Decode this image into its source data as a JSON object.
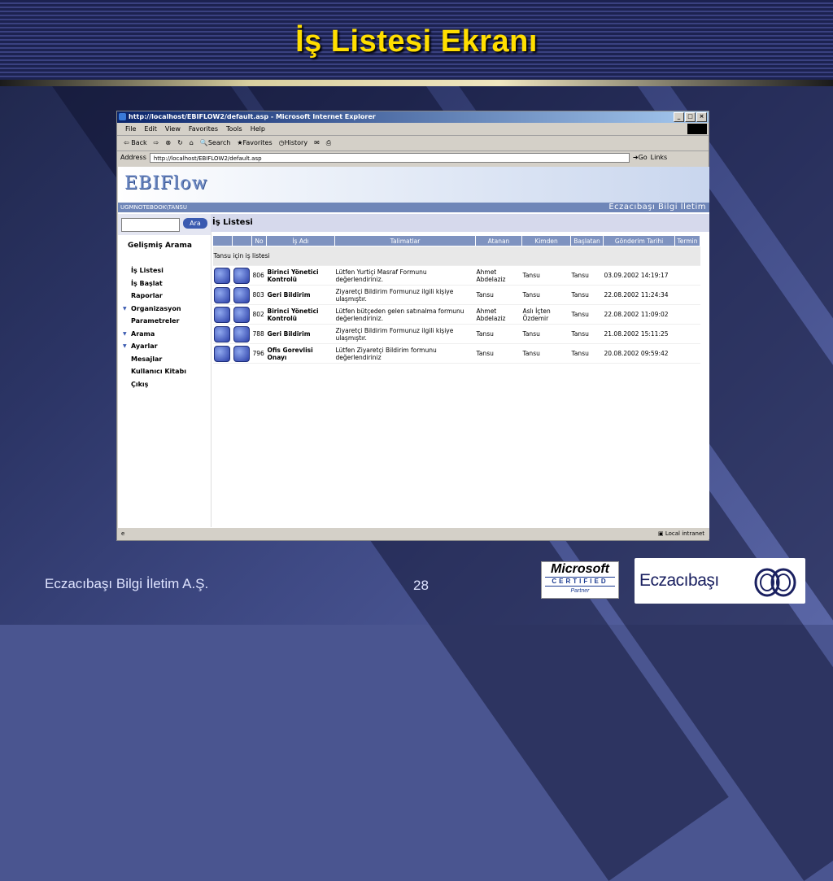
{
  "slide": {
    "title": "İş Listesi Ekranı",
    "footer_left": "Eczacıbaşı Bilgi İletim A.Ş.",
    "page_number": "28"
  },
  "logos": {
    "ms_certified": {
      "line1": "Microsoft",
      "line2": "CERTIFIED",
      "line3": "Partner"
    },
    "eczacibasi": "Eczacıbaşı"
  },
  "browser": {
    "title": "http://localhost/EBIFLOW2/default.asp - Microsoft Internet Explorer",
    "menu": [
      "File",
      "Edit",
      "View",
      "Favorites",
      "Tools",
      "Help"
    ],
    "toolbar": [
      "Back",
      "Search",
      "Favorites",
      "History"
    ],
    "address_label": "Address",
    "address_value": "http://localhost/EBIFLOW2/default.asp",
    "go_label": "Go",
    "links_label": "Links",
    "status_zone": "Local intranet"
  },
  "app": {
    "logo": "EBIFlow",
    "user_path": "UGMNOTEBOOK\\TANSU",
    "company": "Eczacıbaşı Bilgi İletim",
    "search_button": "Ara",
    "advanced_search": "Gelişmiş Arama",
    "menu": [
      {
        "label": "İş Listesi",
        "expanded": false
      },
      {
        "label": "İş Başlat",
        "expanded": false
      },
      {
        "label": "Raporlar",
        "expanded": false
      },
      {
        "label": "Organizasyon",
        "expanded": true
      },
      {
        "label": "Parametreler",
        "expanded": false
      },
      {
        "label": "Arama",
        "expanded": true
      },
      {
        "label": "Ayarlar",
        "expanded": true
      },
      {
        "label": "Mesajlar",
        "expanded": false
      },
      {
        "label": "Kullanıcı Kitabı",
        "expanded": false
      },
      {
        "label": "Çıkış",
        "expanded": false
      }
    ],
    "page_title": "İş Listesi",
    "table": {
      "columns": [
        "No",
        "İş Adı",
        "Talimatlar",
        "Atanan",
        "Kimden",
        "Başlatan",
        "Gönderim Tarihi",
        "Termin"
      ],
      "group_label": "Tansu için iş listesi",
      "rows": [
        {
          "no": "806",
          "name": "Birinci Yönetici Kontrolü",
          "instr": "Lütfen Yurtiçi Masraf Formunu değerlendiriniz.",
          "assigned": "Ahmet Abdelaziz",
          "from": "Tansu",
          "starter": "Tansu",
          "date": "03.09.2002 14:19:17",
          "deadline": ""
        },
        {
          "no": "803",
          "name": "Geri Bildirim",
          "instr": "Ziyaretçi Bildirim Formunuz ilgili kişiye ulaşmıştır.",
          "assigned": "Tansu",
          "from": "Tansu",
          "starter": "Tansu",
          "date": "22.08.2002 11:24:34",
          "deadline": ""
        },
        {
          "no": "802",
          "name": "Birinci Yönetici Kontrolü",
          "instr": "Lütfen bütçeden gelen satınalma formunu değerlendiriniz.",
          "assigned": "Ahmet Abdelaziz",
          "from": "Aslı İçten Özdemir",
          "starter": "Tansu",
          "date": "22.08.2002 11:09:02",
          "deadline": ""
        },
        {
          "no": "788",
          "name": "Geri Bildirim",
          "instr": "Ziyaretçi Bildirim Formunuz ilgili kişiye ulaşmıştır.",
          "assigned": "Tansu",
          "from": "Tansu",
          "starter": "Tansu",
          "date": "21.08.2002 15:11:25",
          "deadline": ""
        },
        {
          "no": "796",
          "name": "Ofis Gorevlisi Onayı",
          "instr": "Lütfen Ziyaretçi Bildirim formunu değerlendiriniz",
          "assigned": "Tansu",
          "from": "Tansu",
          "starter": "Tansu",
          "date": "20.08.2002 09:59:42",
          "deadline": ""
        }
      ]
    }
  }
}
